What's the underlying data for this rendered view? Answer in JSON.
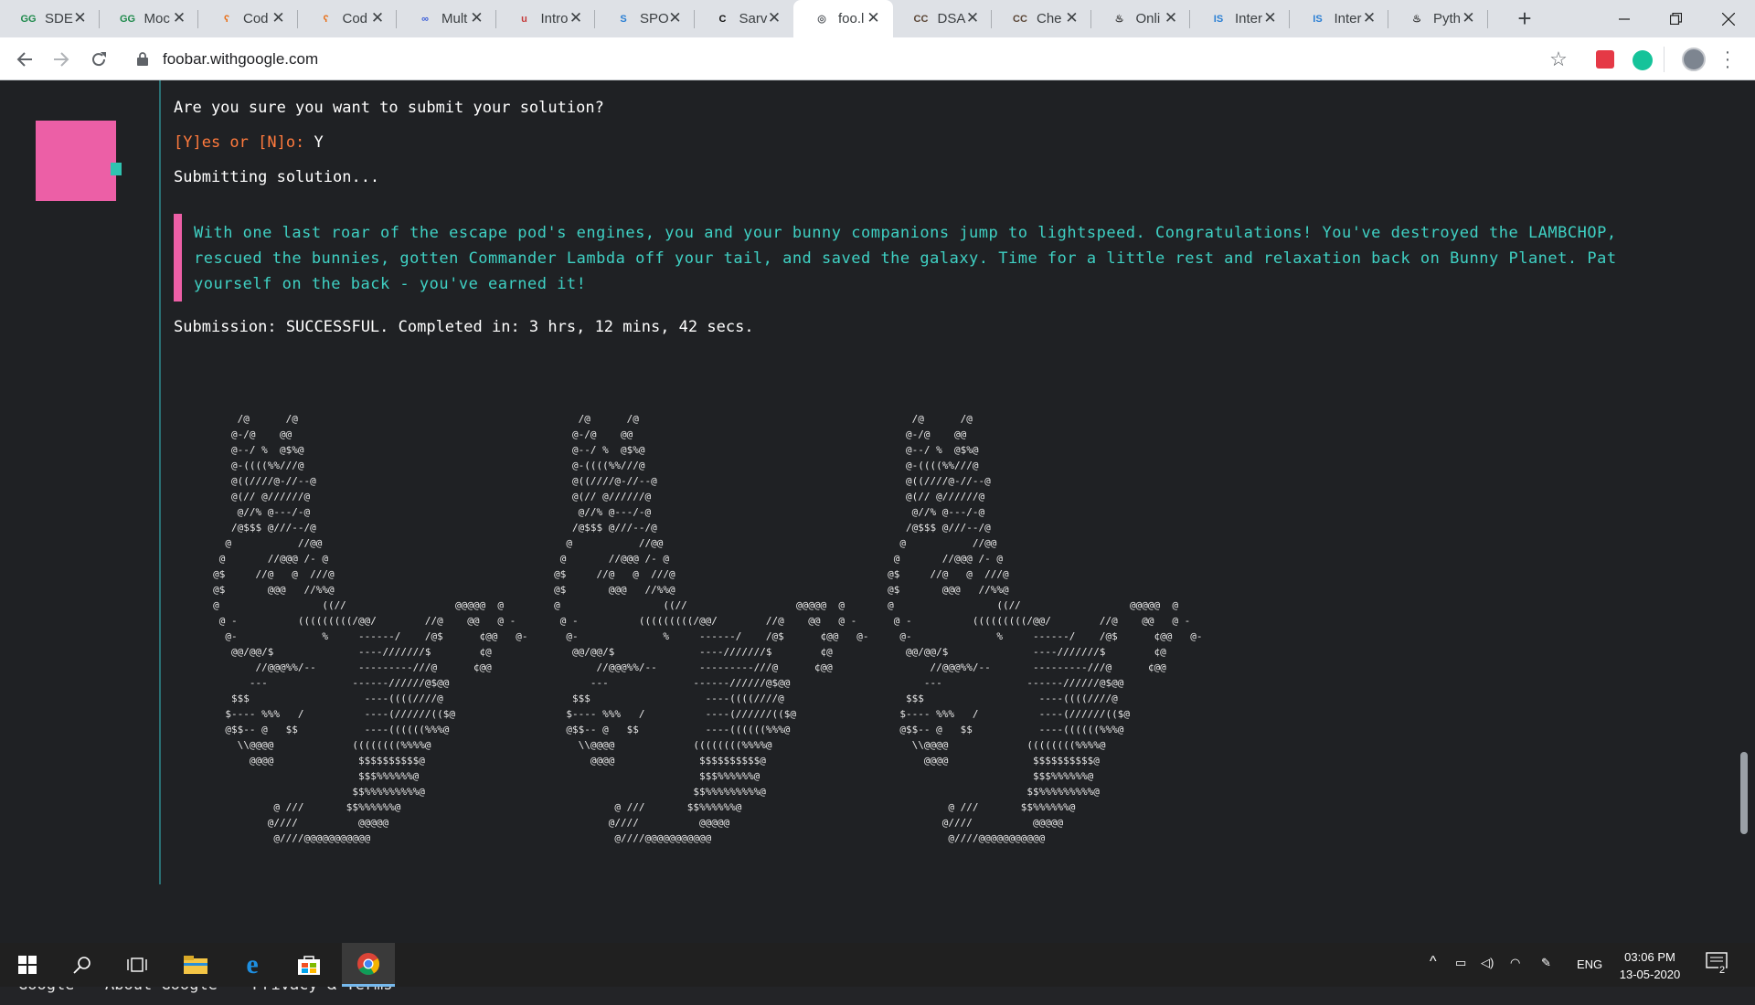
{
  "browser": {
    "tabs": [
      {
        "icon": "GG",
        "label": "SDE",
        "color": "#1f8a4c"
      },
      {
        "icon": "GG",
        "label": "Moc",
        "color": "#1f8a4c"
      },
      {
        "icon": "ʕ",
        "label": "Cod",
        "color": "#e8711b"
      },
      {
        "icon": "ʕ",
        "label": "Cod",
        "color": "#e8711b"
      },
      {
        "icon": "∞",
        "label": "Mult",
        "color": "#3b5dd8"
      },
      {
        "icon": "u",
        "label": "Intro",
        "color": "#c53b3b"
      },
      {
        "icon": "S",
        "label": "SPO",
        "color": "#2a7fd4"
      },
      {
        "icon": "C",
        "label": "Sarv",
        "color": "#111111"
      },
      {
        "icon": "◎",
        "label": "foo.l",
        "color": "#5f6368"
      },
      {
        "icon": "CC",
        "label": "DSA",
        "color": "#5b4636"
      },
      {
        "icon": "CC",
        "label": "Che",
        "color": "#5b4636"
      },
      {
        "icon": "♨",
        "label": "Onli",
        "color": "#333333"
      },
      {
        "icon": "IS",
        "label": "Inter",
        "color": "#2a7fd4"
      },
      {
        "icon": "IS",
        "label": "Inter",
        "color": "#2a7fd4"
      },
      {
        "icon": "♨",
        "label": "Pyth",
        "color": "#333333"
      }
    ],
    "active_tab_index": 8,
    "new_tab": "+",
    "url": "foobar.withgoogle.com"
  },
  "terminal": {
    "question": "Are you sure you want to submit your solution?",
    "prompt_label": "[Y]es or [N]o:",
    "prompt_answer": " Y",
    "submitting": "Submitting solution...",
    "message": "With one last roar of the escape pod's engines, you and your bunny companions jump to lightspeed. Congratulations! You've destroyed the LAMBCHOP, rescued the bunnies, gotten Commander Lambda off your tail, and saved the galaxy. Time for a little rest and relaxation back on Bunny Planet. Pat yourself on the back - you've earned it!",
    "result": "Submission: SUCCESSFUL. Completed in: 3 hrs, 12 mins, 42 secs.",
    "bunny_art": "         /@      /@\n        @-/@    @@\n        @--/ %  @$%@\n        @-((((%%///@\n        @((////@-//--@\n        @(// @//////@\n         @//% @---/-@\n        /@$$$ @///--/@\n       @           //@@\n      @       //@@@ /- @\n     @$     //@   @  ///@\n     @$       @@@   //%%@\n     @                 ((//                  @@@@@  @\n      @ -          (((((((((/@@/        //@    @@   @ -\n       @-              %     ------/    /@$      ¢@@   @-\n        @@/@@/$              ----///////$        ¢@\n            //@@@%%/--       ---------///@      ¢@@\n           ---              ------//////@$@@\n        $$$                   ----((((////@\n       $---- %%%   /          ----(//////(($@\n       @$$-- @   $$           ----((((((%%%@\n         \\\\@@@@             ((((((((%%%%@\n           @@@@              $$$$$$$$$$@\n                             $$$%%%%%%@\n                            $$%%%%%%%%%@\n               @ ///       $$%%%%%%@\n              @////          @@@@@\n               @////@@@@@@@@@@@"
  },
  "footer": {
    "links": [
      "Google",
      "About Google",
      "Privacy & Terms"
    ]
  },
  "taskbar": {
    "language": "ENG",
    "time": "03:06 PM",
    "date": "13-05-2020",
    "notification_count": "2"
  }
}
